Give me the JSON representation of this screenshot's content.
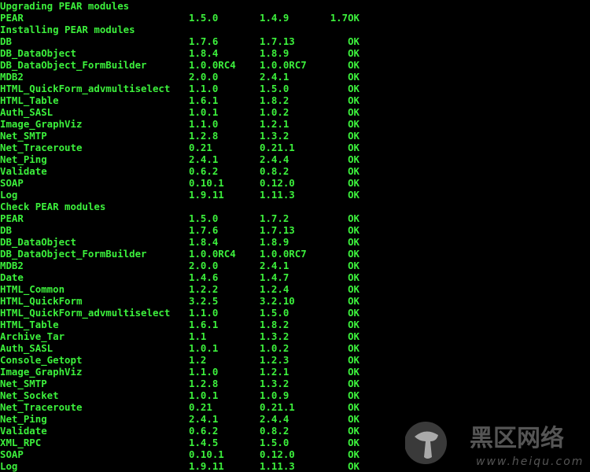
{
  "colors": {
    "text": "#3cf03c",
    "background": "#000000"
  },
  "sections": [
    {
      "heading": "Upgrading PEAR modules",
      "rows": [
        {
          "name": "PEAR",
          "from": "1.5.0",
          "to": "1.4.9",
          "status": "1.7OK"
        }
      ]
    },
    {
      "heading": "Installing PEAR modules",
      "rows": [
        {
          "name": "DB",
          "from": "1.7.6",
          "to": "1.7.13",
          "status": "OK"
        },
        {
          "name": "DB_DataObject",
          "from": "1.8.4",
          "to": "1.8.9",
          "status": "OK"
        },
        {
          "name": "DB_DataObject_FormBuilder",
          "from": "1.0.0RC4",
          "to": "1.0.0RC7",
          "status": "OK"
        },
        {
          "name": "MDB2",
          "from": "2.0.0",
          "to": "2.4.1",
          "status": "OK"
        },
        {
          "name": "HTML_QuickForm_advmultiselect",
          "from": "1.1.0",
          "to": "1.5.0",
          "status": "OK"
        },
        {
          "name": "HTML_Table",
          "from": "1.6.1",
          "to": "1.8.2",
          "status": "OK"
        },
        {
          "name": "Auth_SASL",
          "from": "1.0.1",
          "to": "1.0.2",
          "status": "OK"
        },
        {
          "name": "Image_GraphViz",
          "from": "1.1.0",
          "to": "1.2.1",
          "status": "OK"
        },
        {
          "name": "Net_SMTP",
          "from": "1.2.8",
          "to": "1.3.2",
          "status": "OK"
        },
        {
          "name": "Net_Traceroute",
          "from": "0.21",
          "to": "0.21.1",
          "status": "OK"
        },
        {
          "name": "Net_Ping",
          "from": "2.4.1",
          "to": "2.4.4",
          "status": "OK"
        },
        {
          "name": "Validate",
          "from": "0.6.2",
          "to": "0.8.2",
          "status": "OK"
        },
        {
          "name": "SOAP",
          "from": "0.10.1",
          "to": "0.12.0",
          "status": "OK"
        },
        {
          "name": "Log",
          "from": "1.9.11",
          "to": "1.11.3",
          "status": "OK"
        }
      ]
    },
    {
      "heading": "Check PEAR modules",
      "rows": [
        {
          "name": "PEAR",
          "from": "1.5.0",
          "to": "1.7.2",
          "status": "OK"
        },
        {
          "name": "DB",
          "from": "1.7.6",
          "to": "1.7.13",
          "status": "OK"
        },
        {
          "name": "DB_DataObject",
          "from": "1.8.4",
          "to": "1.8.9",
          "status": "OK"
        },
        {
          "name": "DB_DataObject_FormBuilder",
          "from": "1.0.0RC4",
          "to": "1.0.0RC7",
          "status": "OK"
        },
        {
          "name": "MDB2",
          "from": "2.0.0",
          "to": "2.4.1",
          "status": "OK"
        },
        {
          "name": "Date",
          "from": "1.4.6",
          "to": "1.4.7",
          "status": "OK"
        },
        {
          "name": "HTML_Common",
          "from": "1.2.2",
          "to": "1.2.4",
          "status": "OK"
        },
        {
          "name": "HTML_QuickForm",
          "from": "3.2.5",
          "to": "3.2.10",
          "status": "OK"
        },
        {
          "name": "HTML_QuickForm_advmultiselect",
          "from": "1.1.0",
          "to": "1.5.0",
          "status": "OK"
        },
        {
          "name": "HTML_Table",
          "from": "1.6.1",
          "to": "1.8.2",
          "status": "OK"
        },
        {
          "name": "Archive_Tar",
          "from": "1.1",
          "to": "1.3.2",
          "status": "OK"
        },
        {
          "name": "Auth_SASL",
          "from": "1.0.1",
          "to": "1.0.2",
          "status": "OK"
        },
        {
          "name": "Console_Getopt",
          "from": "1.2",
          "to": "1.2.3",
          "status": "OK"
        },
        {
          "name": "Image_GraphViz",
          "from": "1.1.0",
          "to": "1.2.1",
          "status": "OK"
        },
        {
          "name": "Net_SMTP",
          "from": "1.2.8",
          "to": "1.3.2",
          "status": "OK"
        },
        {
          "name": "Net_Socket",
          "from": "1.0.1",
          "to": "1.0.9",
          "status": "OK"
        },
        {
          "name": "Net_Traceroute",
          "from": "0.21",
          "to": "0.21.1",
          "status": "OK"
        },
        {
          "name": "Net_Ping",
          "from": "2.4.1",
          "to": "2.4.4",
          "status": "OK"
        },
        {
          "name": "Validate",
          "from": "0.6.2",
          "to": "0.8.2",
          "status": "OK"
        },
        {
          "name": "XML_RPC",
          "from": "1.4.5",
          "to": "1.5.0",
          "status": "OK"
        },
        {
          "name": "SOAP",
          "from": "0.10.1",
          "to": "0.12.0",
          "status": "OK"
        },
        {
          "name": "Log",
          "from": "1.9.11",
          "to": "1.11.3",
          "status": "OK"
        }
      ]
    }
  ],
  "watermark": {
    "title": "黑区网络",
    "url": "www.heiqu.com"
  }
}
